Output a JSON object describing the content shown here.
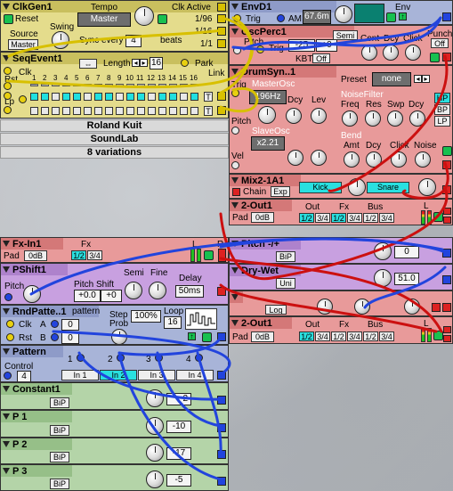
{
  "clkgen": {
    "title": "ClkGen1",
    "reset": "Reset",
    "source": "Source",
    "source_val": "Master",
    "tempo": "Tempo",
    "tempo_val": "Master",
    "swing": "Swing",
    "sync_every": "Sync every",
    "sync_val": "4",
    "beats": "beats",
    "clk_active": "Clk Active",
    "r1": "1/96",
    "r2": "1/16",
    "r3": "1/1"
  },
  "seq": {
    "title": "SeqEvent1",
    "clk": "Clk",
    "rst": "Rst",
    "lp": "Lp",
    "length": "Length",
    "length_val": "16",
    "park": "Park",
    "link": "Link",
    "steps": [
      "1",
      "2",
      "3",
      "4",
      "5",
      "6",
      "7",
      "8",
      "9",
      "10",
      "11",
      "12",
      "13",
      "14",
      "15",
      "16"
    ],
    "t": "T"
  },
  "seq_pattern": [
    1,
    1,
    0,
    1,
    1,
    0,
    1,
    1,
    0,
    1,
    1,
    0,
    1,
    1,
    0,
    1
  ],
  "info": {
    "l1": "Roland Kuit",
    "l2": "SoundLab",
    "l3": "8 variations"
  },
  "envd": {
    "title": "EnvD1",
    "trig": "Trig",
    "am": "AM",
    "time": "67.6m",
    "env": "Env"
  },
  "oscperc": {
    "title": "OscPerc1",
    "pitch": "Pitch",
    "trig": "Trig",
    "semi": "Semi",
    "cent": "Cent",
    "dcy": "Dcy",
    "click": "Click",
    "punch": "Punch",
    "off": "Off",
    "val1": "-25",
    "val2": "+0",
    "kbt": "KBT",
    "kbt_val": "Off"
  },
  "drum": {
    "title": "DrumSyn..1",
    "trig": "Trig",
    "preset": "Preset",
    "preset_val": "none",
    "master": "MasterOsc",
    "freq": "196Hz",
    "dcy": "Dcy",
    "lev": "Lev",
    "noise": "NoiseFilter",
    "nfreq": "Freq",
    "res": "Res",
    "swp": "Swp",
    "ndcy": "Dcy",
    "hp": "HP",
    "bp": "BP",
    "lp": "LP",
    "pitch": "Pitch",
    "slave": "SlaveOsc",
    "ratio": "x2.21",
    "bend": "Bend",
    "amt": "Amt",
    "bdcy": "Dcy",
    "vel": "Vel",
    "bclick": "Click",
    "bnoise": "Noise"
  },
  "mix": {
    "title": "Mix2-1A1",
    "chain": "Chain",
    "exp": "Exp",
    "kick": "Kick",
    "snare": "Snare"
  },
  "out1": {
    "title": "2-Out1",
    "pad": "Pad",
    "pad_val": "0dB",
    "out": "Out",
    "fx": "Fx",
    "bus": "Bus",
    "o": [
      "1/2",
      "3/4",
      "1/2",
      "3/4",
      "1/2",
      "3/4"
    ],
    "l": "L",
    "r": "R"
  },
  "fxin": {
    "title": "Fx-In1",
    "fx": "Fx",
    "pad": "Pad",
    "pad_val": "0dB",
    "a": "1/2",
    "b": "3/4",
    "l": "L",
    "r": "R"
  },
  "pshift": {
    "title": "PShift1",
    "pitch": "Pitch",
    "pshift": "Pitch Shift",
    "semi": "Semi",
    "fine": "Fine",
    "delay": "Delay",
    "v1": "+0.0",
    "v2": "+0",
    "delay_val": "50ms"
  },
  "rnd": {
    "title": "RndPatte..1",
    "pattern": "pattern",
    "clk": "Clk",
    "rst": "Rst",
    "a": "A",
    "a_val": "0",
    "b": "B",
    "b_val": "0",
    "step": "Step",
    "prob": "Prob",
    "prob_val": "100%",
    "loop": "Loop",
    "loop_val": "16"
  },
  "pattern": {
    "title": "Pattern",
    "control": "Control",
    "control_val": "4",
    "n": [
      "1",
      "2",
      "3",
      "4"
    ],
    "in": [
      "In 1",
      "In 2",
      "In 3",
      "In 4"
    ]
  },
  "const": {
    "title": "Constant1",
    "bip": "BiP",
    "val": "2"
  },
  "p1": {
    "title": "P 1",
    "bip": "BiP",
    "val": "-10"
  },
  "p2": {
    "title": "P 2",
    "bip": "BiP",
    "val": "-17"
  },
  "p3": {
    "title": "P 3",
    "bip": "BiP",
    "val": "-5"
  },
  "pitchpm": {
    "title": "Pitch -/+",
    "bip": "BiP",
    "val": "0"
  },
  "drywet": {
    "title": "Dry-Wet",
    "uni": "Uni",
    "val": "51.0"
  },
  "xfade": {
    "log": "Log"
  },
  "out2": {
    "title": "2-Out1",
    "pad": "Pad",
    "pad_val": "0dB",
    "out": "Out",
    "fx": "Fx",
    "bus": "Bus",
    "o": [
      "1/2",
      "3/4",
      "1/2",
      "3/4",
      "1/2",
      "3/4"
    ],
    "l": "L",
    "r": "R"
  },
  "colors": {
    "yellow": "#e4dc8c",
    "salmon": "#e89a9a",
    "purple": "#c8a0e0",
    "blue": "#a8b4d8",
    "green": "#b4d4a8",
    "cyan": "#20e0e0"
  }
}
